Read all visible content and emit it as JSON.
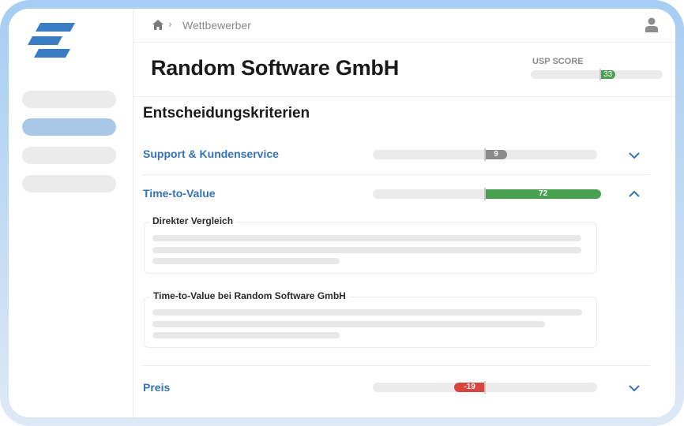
{
  "breadcrumb": {
    "current": "Wettbewerber"
  },
  "header": {
    "company_name": "Random Software GmbH",
    "usp_label": "USP SCORE",
    "usp_value": "33",
    "usp_score": 33
  },
  "section_title": "Entscheidungskriterien",
  "criteria": [
    {
      "label": "Support & Kundenservice",
      "value_text": "9",
      "score": 9,
      "color": "#8a8a8a",
      "expanded": false
    },
    {
      "label": "Time-to-Value",
      "value_text": "72",
      "score": 72,
      "color": "#47a14f",
      "expanded": true
    },
    {
      "label": "Preis",
      "value_text": "-19",
      "score": -19,
      "color": "#d9443f",
      "expanded": false
    }
  ],
  "details": {
    "card1_title": "Direkter Vergleich",
    "card2_title": "Time-to-Value bei Random Software GmbH"
  },
  "colors": {
    "accent": "#3573b4",
    "positive": "#47a14f",
    "negative": "#d9443f",
    "neutral": "#8a8a8a"
  }
}
